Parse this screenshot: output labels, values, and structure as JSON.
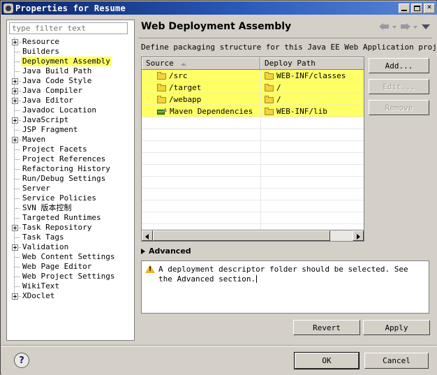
{
  "window": {
    "title": "Properties for Resume",
    "icon": "gear-icon",
    "controls": {
      "minimize": "_",
      "maximize": "□",
      "close": "✕"
    }
  },
  "sidebar": {
    "filter": {
      "value": "",
      "placeholder": "type filter text"
    },
    "items": [
      {
        "label": "Resource",
        "expandable": true,
        "selected": false
      },
      {
        "label": "Builders",
        "expandable": false,
        "selected": false
      },
      {
        "label": "Deployment Assembly",
        "expandable": false,
        "selected": true
      },
      {
        "label": "Java Build Path",
        "expandable": false,
        "selected": false
      },
      {
        "label": "Java Code Style",
        "expandable": true,
        "selected": false
      },
      {
        "label": "Java Compiler",
        "expandable": true,
        "selected": false
      },
      {
        "label": "Java Editor",
        "expandable": true,
        "selected": false
      },
      {
        "label": "Javadoc Location",
        "expandable": false,
        "selected": false
      },
      {
        "label": "JavaScript",
        "expandable": true,
        "selected": false
      },
      {
        "label": "JSP Fragment",
        "expandable": false,
        "selected": false
      },
      {
        "label": "Maven",
        "expandable": true,
        "selected": false
      },
      {
        "label": "Project Facets",
        "expandable": false,
        "selected": false
      },
      {
        "label": "Project References",
        "expandable": false,
        "selected": false
      },
      {
        "label": "Refactoring History",
        "expandable": false,
        "selected": false
      },
      {
        "label": "Run/Debug Settings",
        "expandable": false,
        "selected": false
      },
      {
        "label": "Server",
        "expandable": false,
        "selected": false
      },
      {
        "label": "Service Policies",
        "expandable": false,
        "selected": false
      },
      {
        "label": "SVN 版本控制",
        "expandable": false,
        "selected": false
      },
      {
        "label": "Targeted Runtimes",
        "expandable": false,
        "selected": false
      },
      {
        "label": "Task Repository",
        "expandable": true,
        "selected": false
      },
      {
        "label": "Task Tags",
        "expandable": false,
        "selected": false
      },
      {
        "label": "Validation",
        "expandable": true,
        "selected": false
      },
      {
        "label": "Web Content Settings",
        "expandable": false,
        "selected": false
      },
      {
        "label": "Web Page Editor",
        "expandable": false,
        "selected": false
      },
      {
        "label": "Web Project Settings",
        "expandable": false,
        "selected": false
      },
      {
        "label": "WikiText",
        "expandable": false,
        "selected": false
      },
      {
        "label": "XDoclet",
        "expandable": true,
        "selected": false
      }
    ]
  },
  "main": {
    "page_title": "Web Deployment Assembly",
    "header_icons": [
      "back-arrow-icon",
      "back-dropdown-icon",
      "forward-arrow-icon",
      "forward-dropdown-icon",
      "view-menu-icon"
    ],
    "description": "Define packaging structure for this Java EE Web Application project.",
    "table": {
      "columns": [
        "Source",
        "Deploy Path"
      ],
      "sort_column": "Source",
      "sort_direction": "asc",
      "rows": [
        {
          "icon": "folder-icon",
          "source": "/src",
          "deploy_path": "WEB-INF/classes",
          "deploy_icon": "folder-icon"
        },
        {
          "icon": "folder-icon",
          "source": "/target",
          "deploy_path": "/",
          "deploy_icon": "folder-icon"
        },
        {
          "icon": "folder-icon",
          "source": "/webapp",
          "deploy_path": "/",
          "deploy_icon": "folder-icon"
        },
        {
          "icon": "maven-icon",
          "source": "Maven Dependencies",
          "deploy_path": "WEB-INF/lib",
          "deploy_icon": "folder-icon"
        }
      ],
      "empty_row_count": 11
    },
    "buttons": [
      {
        "label": "Add...",
        "enabled": true
      },
      {
        "label": "Edit...",
        "enabled": false
      },
      {
        "label": "Remove",
        "enabled": false
      }
    ],
    "advanced": {
      "label": "Advanced",
      "expanded": false
    },
    "message": {
      "icon": "warning-icon",
      "text": "A deployment descriptor folder should be selected. See the Advanced section."
    },
    "revert_label": "Revert",
    "apply_label": "Apply"
  },
  "footer": {
    "help_label": "?",
    "ok_label": "OK",
    "cancel_label": "Cancel"
  },
  "colors": {
    "titlebar_start": "#0a246a",
    "titlebar_end": "#5a86d8",
    "dialog_bg": "#d4d0c8",
    "highlight_yellow": "#ffff66",
    "folder_yellow": "#f2d33c",
    "warning_orange": "#f0b41e"
  }
}
